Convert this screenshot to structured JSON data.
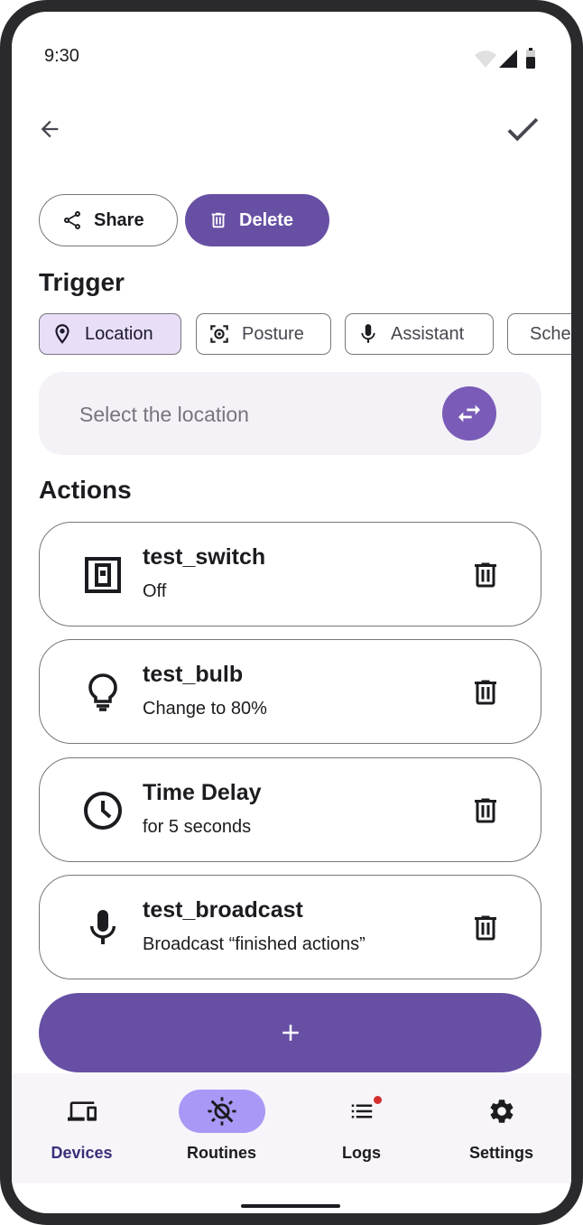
{
  "status_bar": {
    "time": "9:30",
    "icons": [
      "wifi-icon",
      "signal-icon",
      "battery-icon"
    ]
  },
  "top_bar": {
    "back_icon": "arrow-back-icon",
    "confirm_icon": "check-icon"
  },
  "header_buttons": {
    "share_label": "Share",
    "delete_label": "Delete"
  },
  "trigger": {
    "title": "Trigger",
    "chips": [
      {
        "label": "Location",
        "icon": "location-pin-icon",
        "selected": true
      },
      {
        "label": "Posture",
        "icon": "posture-icon",
        "selected": false
      },
      {
        "label": "Assistant",
        "icon": "microphone-icon",
        "selected": false
      },
      {
        "label": "Schedule",
        "icon": "clock-icon",
        "selected": false
      }
    ],
    "location_placeholder": "Select the location"
  },
  "actions": {
    "title": "Actions",
    "items": [
      {
        "title": "test_switch",
        "subtitle": "Off",
        "icon": "switch-icon"
      },
      {
        "title": "test_bulb",
        "subtitle": "Change to 80%",
        "icon": "lightbulb-icon"
      },
      {
        "title": "Time Delay",
        "subtitle": "for 5 seconds",
        "icon": "clock-icon"
      },
      {
        "title": "test_broadcast",
        "subtitle": "Broadcast “finished actions”",
        "icon": "microphone-icon"
      }
    ],
    "add_label": "+"
  },
  "nav": {
    "items": [
      {
        "label": "Devices",
        "icon": "devices-icon",
        "active": true
      },
      {
        "label": "Routines",
        "icon": "routines-icon",
        "active": false
      },
      {
        "label": "Logs",
        "icon": "logs-icon",
        "active": false,
        "badge": true
      },
      {
        "label": "Settings",
        "icon": "gear-icon",
        "active": false
      }
    ]
  },
  "colors": {
    "primary": "#6750a4",
    "selected_chip": "#e8def8",
    "nav_pill": "#a998f5",
    "badge": "#d32f2f"
  }
}
